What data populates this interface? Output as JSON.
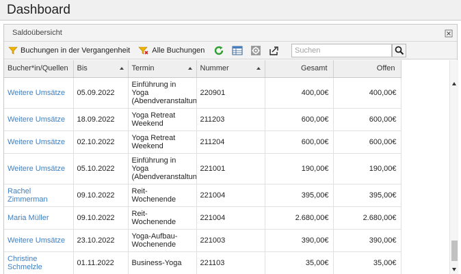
{
  "header": {
    "title": "Dashboard"
  },
  "widget": {
    "title": "Saldoübersicht"
  },
  "toolbar": {
    "past_bookings_label": "Buchungen in der Vergangenheit",
    "all_bookings_label": "Alle Buchungen",
    "search_placeholder": "Suchen",
    "filter_color": "#f0b400",
    "refresh_color": "#2e9e2e"
  },
  "table": {
    "columns": {
      "bucher": "Bucher*in/Quellen",
      "bis": "Bis",
      "termin": "Termin",
      "nummer": "Nummer",
      "gesamt": "Gesamt",
      "offen": "Offen"
    },
    "rows": [
      {
        "bucher": "Weitere Umsätze",
        "bis": "05.09.2022",
        "termin": "Einführung in\nYoga\n(Abendveranstaltung)",
        "nummer": "220901",
        "gesamt": "400,00€",
        "offen": "400,00€"
      },
      {
        "bucher": "Weitere Umsätze",
        "bis": "18.09.2022",
        "termin": "Yoga Retreat\nWeekend",
        "nummer": "211203",
        "gesamt": "600,00€",
        "offen": "600,00€"
      },
      {
        "bucher": "Weitere Umsätze",
        "bis": "02.10.2022",
        "termin": "Yoga Retreat\nWeekend",
        "nummer": "211204",
        "gesamt": "600,00€",
        "offen": "600,00€"
      },
      {
        "bucher": "Weitere Umsätze",
        "bis": "05.10.2022",
        "termin": "Einführung in\nYoga\n(Abendveranstaltung)",
        "nummer": "221001",
        "gesamt": "190,00€",
        "offen": "190,00€"
      },
      {
        "bucher": "Rachel\nZimmerman",
        "bis": "09.10.2022",
        "termin": "Reit-\nWochenende",
        "nummer": "221004",
        "gesamt": "395,00€",
        "offen": "395,00€"
      },
      {
        "bucher": "Maria Müller",
        "bis": "09.10.2022",
        "termin": "Reit-\nWochenende",
        "nummer": "221004",
        "gesamt": "2.680,00€",
        "offen": "2.680,00€"
      },
      {
        "bucher": "Weitere Umsätze",
        "bis": "23.10.2022",
        "termin": "Yoga-Aufbau-\nWochenende",
        "nummer": "221003",
        "gesamt": "390,00€",
        "offen": "390,00€"
      },
      {
        "bucher": "Christine\nSchmelzle",
        "bis": "01.11.2022",
        "termin": "Business-Yoga",
        "nummer": "221103",
        "gesamt": "35,00€",
        "offen": "35,00€"
      }
    ]
  }
}
